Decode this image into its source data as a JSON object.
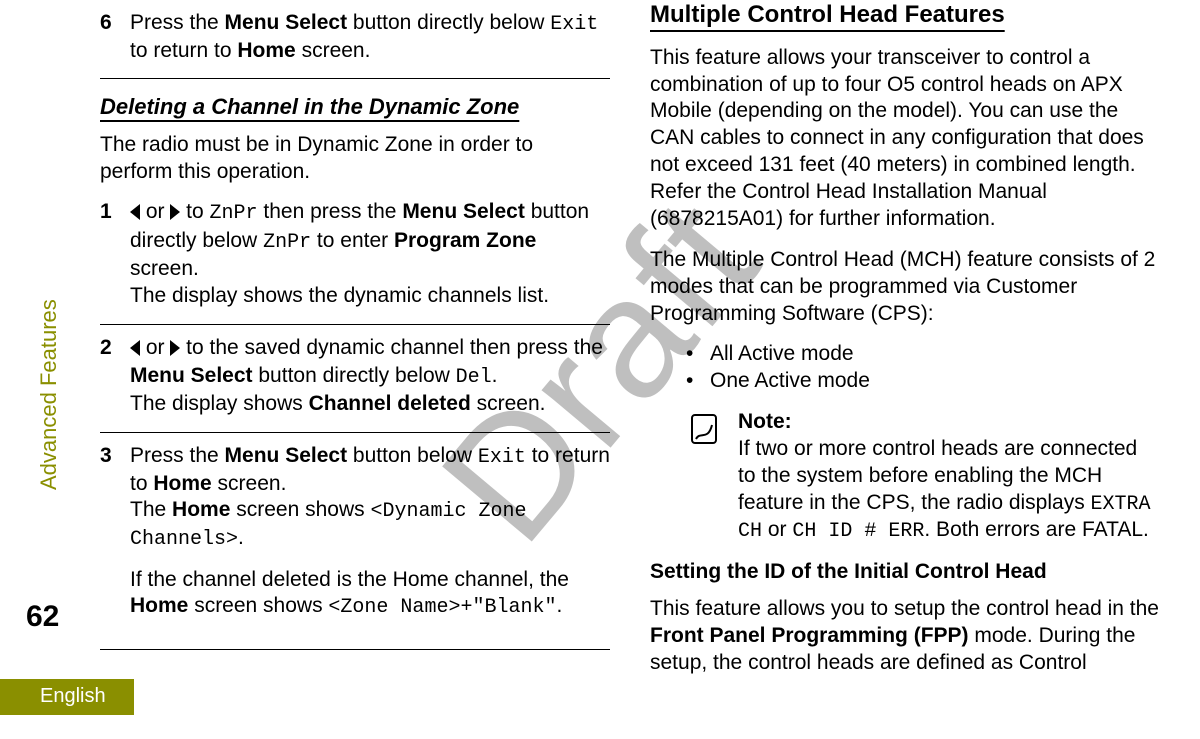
{
  "watermark": "Draft",
  "sidebar_label": "Advanced Features",
  "page_number": "62",
  "language_tab": "English",
  "left": {
    "step6": {
      "num": "6",
      "t1": "Press the ",
      "b1": "Menu Select",
      "t2": " button directly below ",
      "code1": "Exit",
      "t3": " to return to ",
      "b2": "Home",
      "t4": " screen."
    },
    "sub_heading": "Deleting a Channel in the Dynamic Zone",
    "intro": "The radio must be in Dynamic Zone in order to perform this operation.",
    "s1": {
      "num": "1",
      "t1": " or ",
      "t2": " to ",
      "code1": "ZnPr",
      "t3": " then press the ",
      "b1": "Menu Select",
      "t4": " button directly below ",
      "code2": "ZnPr",
      "t5": " to enter ",
      "b2": "Program Zone",
      "t6": " screen.",
      "line2": "The display shows the dynamic channels list."
    },
    "s2": {
      "num": "2",
      "t1": " or ",
      "t2": " to the saved dynamic channel then press the ",
      "b1": "Menu Select",
      "t3": " button directly below ",
      "code1": "Del",
      "t4": ".",
      "line2a": "The display shows ",
      "line2b": "Channel deleted",
      "line2c": " screen."
    },
    "s3": {
      "num": "3",
      "t1": "Press the ",
      "b1": "Menu Select",
      "t2": " button below ",
      "code1": "Exit",
      "t3": " to return to ",
      "b2": "Home",
      "t4": " screen.",
      "line2a": "The ",
      "line2b": "Home",
      "line2c": " screen shows ",
      "code2": "<Dynamic Zone Channels>",
      "line2d": ".",
      "line3a": "If the channel deleted is the Home channel, the ",
      "line3b": "Home",
      "line3c": " screen shows ",
      "code3": "<Zone Name>+\"Blank\"",
      "line3d": "."
    }
  },
  "right": {
    "heading": "Multiple Control Head Features",
    "p1": "This feature allows your transceiver to control a combination of up to four O5 control heads on APX Mobile (depending on the model). You can use the CAN cables to connect in any configuration that does not exceed 131 feet (40 meters) in combined length. Refer the Control Head Installation Manual (6878215A01) for further information.",
    "p2": "The Multiple Control Head (MCH) feature consists of 2 modes that can be programmed via Customer Programming Software (CPS):",
    "bullets": [
      "All Active mode",
      "One Active mode"
    ],
    "note": {
      "title": "Note:",
      "t1": "If two or more control heads are connected to the system before enabling the MCH feature in the CPS, the radio displays ",
      "code1": "EXTRA CH",
      "t2": " or ",
      "code2": "CH ID # ERR",
      "t3": ". Both errors are FATAL."
    },
    "sub2": "Setting the ID of the Initial Control Head",
    "p3a": "This feature allows you to setup the control head in the ",
    "p3b": "Front Panel Programming (FPP)",
    "p3c": " mode. During the setup, the control heads are defined as Control"
  }
}
